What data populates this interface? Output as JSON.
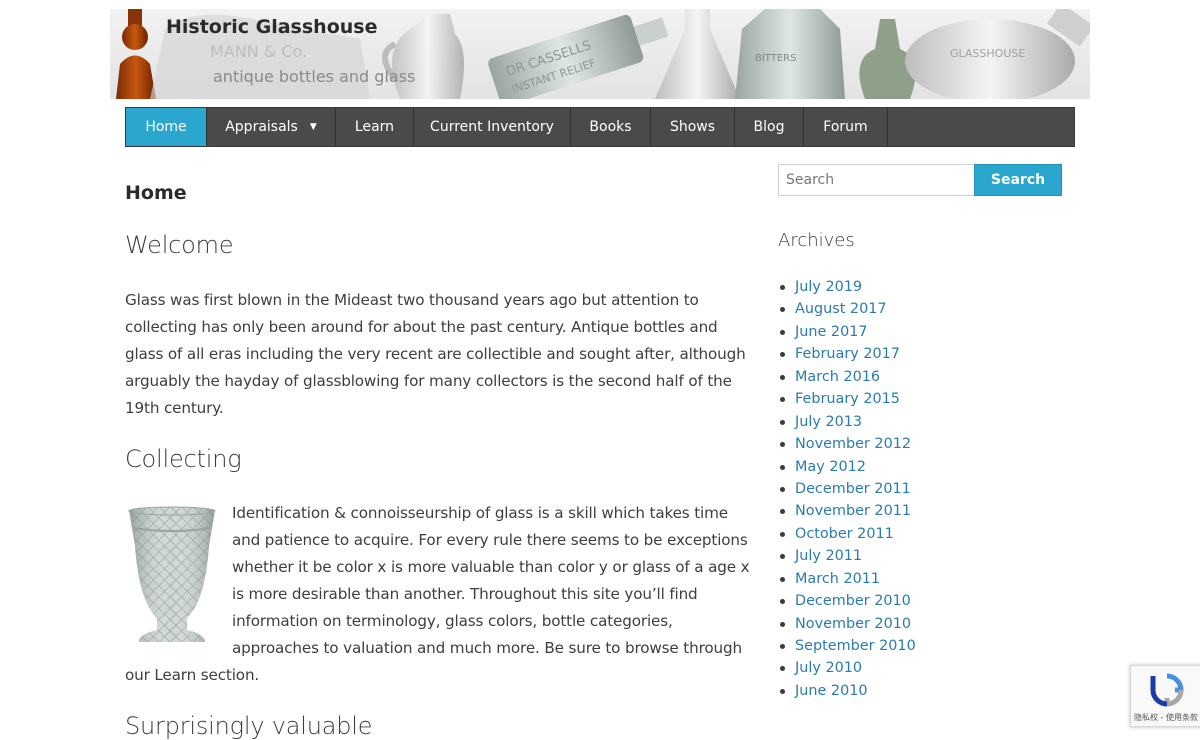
{
  "header": {
    "site_title": "Historic Glasshouse",
    "tagline": "antique bottles and glass",
    "banner_embossing": [
      "MANN & Co.",
      "DR CASSELLS",
      "INSTANT RELIEF",
      "BITTERS",
      "GLASSHOUSE"
    ]
  },
  "nav": {
    "items": [
      {
        "label": "Home",
        "active": true
      },
      {
        "label": "Appraisals",
        "has_dropdown": true
      },
      {
        "label": "Learn"
      },
      {
        "label": "Current Inventory"
      },
      {
        "label": "Books"
      },
      {
        "label": "Shows"
      },
      {
        "label": "Blog"
      },
      {
        "label": "Forum"
      }
    ],
    "dropdown_caret": "▼"
  },
  "main": {
    "page_title": "Home",
    "sections": [
      {
        "heading": "Welcome",
        "text": "Glass was first blown in the Mideast two thousand years ago but attention to collecting has only been around for about the past century. Antique bottles and glass of all eras including the very recent are collectible and sought after, although arguably the hayday of glassblowing for many collectors is the second half of the 19th century."
      },
      {
        "heading": "Collecting",
        "text": "Identification & connoisseurship of glass is a skill which takes time and patience to acquire. For every rule there seems to be exceptions whether it be color x is more valuable than color y or glass of a age x is more desirable than another. Throughout this site you’ll find information on terminology, glass colors, bottle categories, approaches to valuation and much more. Be sure to browse through our Learn section."
      },
      {
        "heading": "Surprisingly valuable"
      }
    ]
  },
  "sidebar": {
    "search": {
      "placeholder": "Search",
      "button_label": "Search"
    },
    "archives": {
      "title": "Archives",
      "items": [
        "July 2019",
        "August 2017",
        "June 2017",
        "February 2017",
        "March 2016",
        "February 2015",
        "July 2013",
        "November 2012",
        "May 2012",
        "December 2011",
        "November 2011",
        "October 2011",
        "July 2011",
        "March 2011",
        "December 2010",
        "November 2010",
        "September 2010",
        "July 2010",
        "June 2010"
      ]
    }
  },
  "recaptcha": {
    "label": "隐私权 - 使用条款"
  },
  "colors": {
    "accent": "#2aa6cf",
    "nav_bg": "#4a4a4a",
    "link": "#2a7bb0"
  }
}
